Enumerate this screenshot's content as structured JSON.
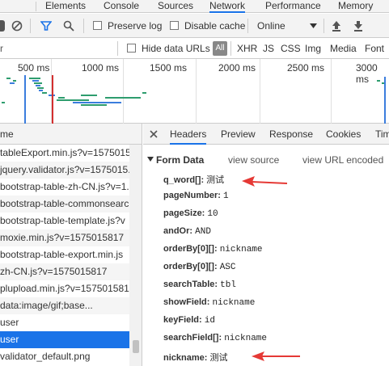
{
  "tabs": [
    {
      "label": "Elements"
    },
    {
      "label": "Console"
    },
    {
      "label": "Sources"
    },
    {
      "label": "Network"
    },
    {
      "label": "Performance"
    },
    {
      "label": "Memory"
    }
  ],
  "toolbar": {
    "preserve_log": "Preserve log",
    "disable_cache": "Disable cache",
    "throttle": "Online"
  },
  "filter": {
    "hide_data_urls": "Hide data URLs",
    "all": "All",
    "types": [
      "XHR",
      "JS",
      "CSS",
      "Img",
      "Media",
      "Font"
    ]
  },
  "timeline": {
    "ticks": [
      "500 ms",
      "1000 ms",
      "1500 ms",
      "2000 ms",
      "2500 ms",
      "3000 ms"
    ]
  },
  "list": {
    "header": "me",
    "rows": [
      "tableExport.min.js?v=1575015",
      "jquery.validator.js?v=1575015.",
      "bootstrap-table-zh-CN.js?v=1.",
      "bootstrap-table-commonsearc",
      "bootstrap-table-template.js?v",
      "moxie.min.js?v=1575015817",
      "bootstrap-table-export.min.js",
      "zh-CN.js?v=1575015817",
      "plupload.min.js?v=157501581",
      "data:image/gif;base...",
      "user",
      "user",
      "validator_default.png"
    ],
    "selected_index": 11
  },
  "detail": {
    "tabs": [
      "Headers",
      "Preview",
      "Response",
      "Cookies",
      "Tim"
    ],
    "section_title": "Form Data",
    "view_source": "view source",
    "view_url_encoded": "view URL encoded",
    "fields": [
      {
        "key": "q_word[]:",
        "value": "测试"
      },
      {
        "key": "pageNumber:",
        "value": "1"
      },
      {
        "key": "pageSize:",
        "value": "10"
      },
      {
        "key": "andOr:",
        "value": "AND"
      },
      {
        "key": "orderBy[0][]:",
        "value": "nickname"
      },
      {
        "key": "orderBy[0][]:",
        "value": "ASC"
      },
      {
        "key": "searchTable:",
        "value": "tbl"
      },
      {
        "key": "showField:",
        "value": "nickname"
      },
      {
        "key": "keyField:",
        "value": "id"
      },
      {
        "key": "searchField[]:",
        "value": "nickname"
      },
      {
        "key": "nickname:",
        "value": "测试"
      }
    ]
  },
  "colors": {
    "accent": "#1a73e8",
    "annotation_arrow": "#e53935",
    "waterfall_green": "#2e9d6e",
    "waterfall_blue": "#3b7ddd",
    "marker_red": "#d32f2f"
  }
}
